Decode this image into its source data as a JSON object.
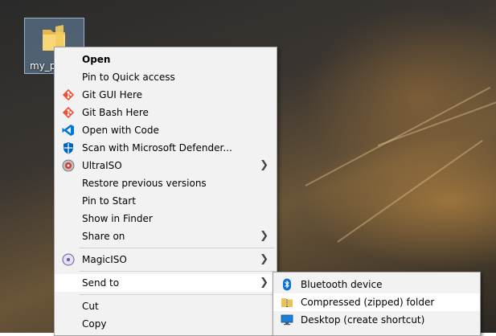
{
  "desktop": {
    "icon_label": "my_p"
  },
  "context_menu": {
    "items": [
      {
        "label": "Open",
        "icon": "none"
      },
      {
        "label": "Pin to Quick access",
        "icon": "none"
      },
      {
        "label": "Git GUI Here",
        "icon": "git-icon"
      },
      {
        "label": "Git Bash Here",
        "icon": "git-icon"
      },
      {
        "label": "Open with Code",
        "icon": "vscode-icon"
      },
      {
        "label": "Scan with Microsoft Defender...",
        "icon": "defender-shield-icon"
      },
      {
        "label": "UltraISO",
        "icon": "ultraiso-disc-icon"
      },
      {
        "label": "Restore previous versions",
        "icon": "none"
      },
      {
        "label": "Pin to Start",
        "icon": "none"
      },
      {
        "label": "Show in Finder",
        "icon": "none"
      },
      {
        "label": "Share on",
        "icon": "none"
      },
      {
        "label": "MagicISO",
        "icon": "magiciso-disc-icon"
      },
      {
        "label": "Send to",
        "icon": "none"
      },
      {
        "label": "Cut",
        "icon": "none"
      },
      {
        "label": "Copy",
        "icon": "none"
      }
    ]
  },
  "sendto_menu": {
    "items": [
      {
        "label": "Bluetooth device",
        "icon": "bluetooth-icon"
      },
      {
        "label": "Compressed (zipped) folder",
        "icon": "zip-folder-icon"
      },
      {
        "label": "Desktop (create shortcut)",
        "icon": "desktop-icon"
      }
    ]
  },
  "colors": {
    "menu_bg": "#f2f2f2",
    "highlight": "#ffffff",
    "git": "#f05033",
    "vscode": "#0078d4",
    "defender": "#0067b8",
    "bluetooth": "#0a6fd6"
  }
}
